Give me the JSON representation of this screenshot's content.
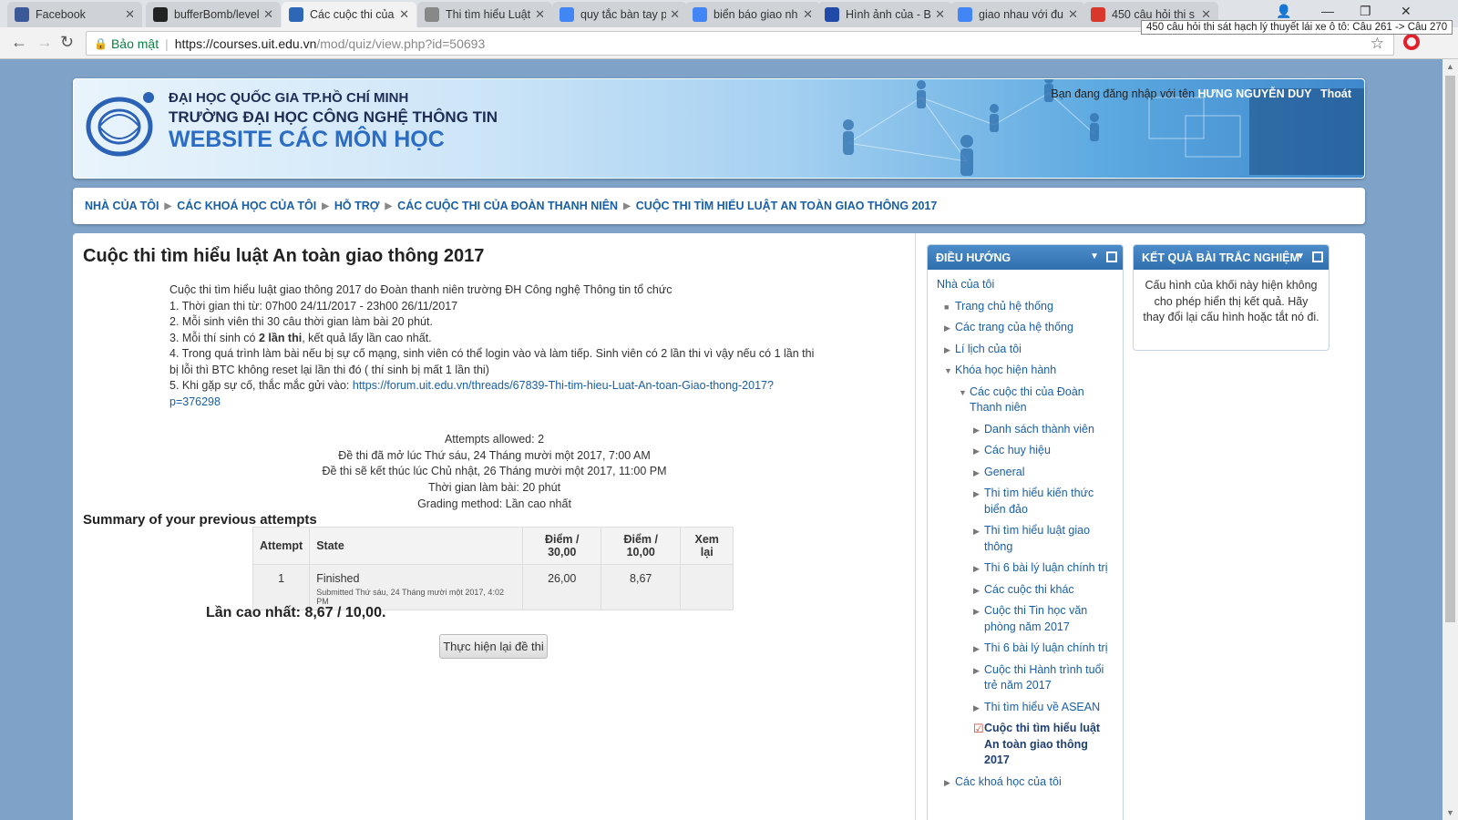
{
  "tabs": [
    {
      "title": "Facebook",
      "icon": "facebook-icon",
      "color": "#3b5998"
    },
    {
      "title": "bufferBomb/level",
      "icon": "github-icon",
      "color": "#222"
    },
    {
      "title": "Các cuộc thi của",
      "icon": "moodle-icon",
      "color": "#2d67b5"
    },
    {
      "title": "Thi tìm hiểu Luật",
      "icon": "page-icon",
      "color": "#888"
    },
    {
      "title": "quy tắc bàn tay p",
      "icon": "google-icon",
      "color": "#4285f4"
    },
    {
      "title": "biển báo giao nh",
      "icon": "google-icon",
      "color": "#4285f4"
    },
    {
      "title": "Hình ảnh của - B",
      "icon": "vn-icon",
      "color": "#1f4aa8"
    },
    {
      "title": "giao nhau với đu",
      "icon": "google-icon",
      "color": "#4285f4"
    },
    {
      "title": "450 câu hỏi thi s",
      "icon": "car-icon",
      "color": "#d9362c"
    }
  ],
  "tooltip": "450 câu hỏi thi sát hạch lý thuyết lái xe ô tô: Câu 261 -> Câu 270",
  "address": {
    "security_label": "Bảo mật",
    "host": "https://courses.uit.edu.vn",
    "path": "/mod/quiz/view.php?id=50693"
  },
  "header": {
    "line1": "ĐẠI HỌC QUỐC GIA TP.HỒ CHÍ MINH",
    "line2": "TRƯỜNG ĐẠI HỌC CÔNG NGHỆ THÔNG TIN",
    "line3": "WEBSITE CÁC MÔN HỌC",
    "login_prefix": "Bạn đang đăng nhập với tên",
    "username": "HƯNG NGUYỄN DUY",
    "logout": "Thoát"
  },
  "breadcrumb": [
    "NHÀ CỦA TÔI",
    "CÁC KHOÁ HỌC CỦA TÔI",
    "HỖ TRỢ",
    "CÁC CUỘC THI CỦA ĐOÀN THANH NIÊN",
    "CUỘC THI TÌM HIỂU LUẬT AN TOÀN GIAO THÔNG 2017"
  ],
  "page": {
    "title": "Cuộc thi tìm hiểu luật An toàn giao thông 2017",
    "intro_line1": "Cuộc thi tìm hiểu luật giao thông 2017 do Đoàn thanh niên trường ĐH Công nghệ Thông tin tổ chức",
    "intro_line2": "1. Thời gian thi từ: 07h00 24/11/2017 - 23h00 26/11/2017",
    "intro_line3": "2. Mỗi sinh viên thi 30 câu thời gian làm bài 20 phút.",
    "intro_line4_pre": "3. Mỗi thí sinh có ",
    "intro_line4_bold": "2 lần thi",
    "intro_line4_post": ", kết quả lấy lần cao nhất.",
    "intro_line5": "4. Trong quá trình làm bài nếu bị sự cố mạng, sinh viên có thể login vào và làm tiếp. Sinh viên có 2 lần thi vì vậy nếu có 1 lần thi bị lỗi thì BTC không reset lại lần thi đó ( thí sinh bị mất 1 lần thi)",
    "intro_line6_pre": "5. Khi gặp sự cố, thắc mắc gửi vào: ",
    "intro_link": "https://forum.uit.edu.vn/threads/67839-Thi-tim-hieu-Luat-An-toan-Giao-thong-2017?p=376298",
    "attempts_allowed": "Attempts allowed: 2",
    "opened": "Đề thi đã mở lúc Thứ sáu, 24 Tháng mười một 2017, 7:00 AM",
    "closes": "Đề thi sẽ kết thúc lúc Chủ nhật, 26 Tháng mười một 2017, 11:00 PM",
    "time_limit": "Thời gian làm bài: 20 phút",
    "grading": "Grading method: Lần cao nhất",
    "summary_heading": "Summary of your previous attempts",
    "table_headers": [
      "Attempt",
      "State",
      "Điểm / 30,00",
      "Điểm / 10,00",
      "Xem lại"
    ],
    "rows": [
      {
        "attempt": "1",
        "state": "Finished",
        "submitted": "Submitted Thứ sáu, 24 Tháng mười một 2017, 4:02 PM",
        "score30": "26,00",
        "score10": "8,67",
        "review": ""
      }
    ],
    "best": "Lần cao nhất: 8,67 / 10,00.",
    "retry_button": "Thực hiện lại đề thi"
  },
  "nav_block": {
    "title": "ĐIỀU HƯỚNG",
    "items": [
      {
        "label": "Nhà của tôi",
        "level": 0,
        "marker": ""
      },
      {
        "label": "Trang chủ hệ thống",
        "level": 1,
        "marker": "■"
      },
      {
        "label": "Các trang của hệ thống",
        "level": 1,
        "marker": "▶"
      },
      {
        "label": "Lí lịch của tôi",
        "level": 1,
        "marker": "▶"
      },
      {
        "label": "Khóa học hiện hành",
        "level": 1,
        "marker": "▼"
      },
      {
        "label": "Các cuộc thi của Đoàn Thanh niên",
        "level": 2,
        "marker": "▼"
      },
      {
        "label": "Danh sách thành viên",
        "level": 3,
        "marker": "▶"
      },
      {
        "label": "Các huy hiệu",
        "level": 3,
        "marker": "▶"
      },
      {
        "label": "General",
        "level": 3,
        "marker": "▶"
      },
      {
        "label": "Thi tìm hiểu kiến thức biển đảo",
        "level": 3,
        "marker": "▶"
      },
      {
        "label": "Thi tìm hiểu luật giao thông",
        "level": 3,
        "marker": "▶"
      },
      {
        "label": "Thi 6 bài lý luận chính trị",
        "level": 3,
        "marker": "▶"
      },
      {
        "label": "Các cuộc thi khác",
        "level": 3,
        "marker": "▶"
      },
      {
        "label": "Cuộc thi Tin học văn phòng năm 2017",
        "level": 3,
        "marker": "▶"
      },
      {
        "label": "Thi 6 bài lý luận chính trị",
        "level": 3,
        "marker": "▶"
      },
      {
        "label": "Cuộc thi Hành trình tuổi trẻ năm 2017",
        "level": 3,
        "marker": "▶"
      },
      {
        "label": "Thi tìm hiểu về ASEAN",
        "level": 3,
        "marker": "▶"
      },
      {
        "label": "Cuộc thi tìm hiểu luật An toàn giao thông 2017",
        "level": 3,
        "marker": "quiz",
        "current": true
      },
      {
        "label": "Các khoá học của tôi",
        "level": 1,
        "marker": "▶"
      }
    ]
  },
  "result_block": {
    "title": "KẾT QUẢ BÀI TRẮC NGHIỆM",
    "body": "Cấu hình của khối này hiện không cho phép hiển thị kết quả. Hãy thay đổi lại cấu hình hoặc tắt nó đi."
  }
}
